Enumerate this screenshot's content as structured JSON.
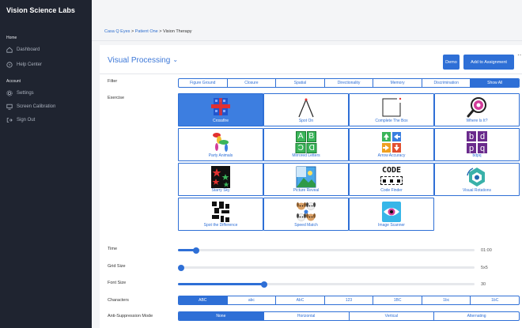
{
  "sidebar": {
    "brand": "Vision Science Labs",
    "home_section": "Home",
    "items": [
      {
        "label": "Dashboard",
        "icon": "home-icon"
      },
      {
        "label": "Help Center",
        "icon": "help-icon"
      }
    ],
    "account_section": "Account",
    "account_items": [
      {
        "label": "Settings",
        "icon": "gear-icon"
      },
      {
        "label": "Screen Calibration",
        "icon": "monitor-icon"
      },
      {
        "label": "Sign Out",
        "icon": "sign-out-icon"
      }
    ]
  },
  "breadcrumb": {
    "crumb1": "Casa Q Eyes",
    "sep": ">",
    "crumb2": "Patient One",
    "crumb3": "Vision Therapy"
  },
  "panel": {
    "title": "Visual Processing",
    "title_caret": "⌄",
    "demo_label": "Demo",
    "assign_label": "Add to Assignment",
    "kebab": "⋯"
  },
  "filter": {
    "label": "Filter",
    "tabs": [
      "Figure Ground",
      "Closure",
      "Spatial",
      "Directionality",
      "Memory",
      "Discrimination",
      "Show All"
    ],
    "active": "Show All"
  },
  "exercise": {
    "label": "Exercise",
    "cards": [
      {
        "label": "Crossfire",
        "icon": "crossfire-icon",
        "selected": true
      },
      {
        "label": "Spot On",
        "icon": "spot-on-icon"
      },
      {
        "label": "Complete The Box",
        "icon": "complete-box-icon"
      },
      {
        "label": "Where Is It?",
        "icon": "magnifier-icon"
      },
      {
        "label": "Party Animals",
        "icon": "balloon-dog-icon"
      },
      {
        "label": "Mirrored Letters",
        "icon": "mirrored-letters-icon"
      },
      {
        "label": "Arrow Accuracy",
        "icon": "arrows-icon"
      },
      {
        "label": "bdpq",
        "icon": "bdpq-icon"
      },
      {
        "label": "Starry Sky",
        "icon": "stars-icon"
      },
      {
        "label": "Picture Reveal",
        "icon": "picture-icon"
      },
      {
        "label": "Code Finder",
        "icon": "code-icon"
      },
      {
        "label": "Visual Rotations",
        "icon": "rotation-icon"
      },
      {
        "label": "Spot the Difference",
        "icon": "pattern-icon"
      },
      {
        "label": "Speed Match",
        "icon": "dogs-icon"
      },
      {
        "label": "Image Scanner",
        "icon": "eye-icon"
      }
    ],
    "bdpq_letters": [
      "b",
      "d",
      "p",
      "q"
    ],
    "code_text": "CODE",
    "mirrored_letters": [
      "A",
      "B",
      "C",
      "D"
    ]
  },
  "time": {
    "label": "Time",
    "value": "01:00",
    "fraction": 0.06
  },
  "grid_size": {
    "label": "Grid Size",
    "value": "5x5",
    "fraction": 0.0
  },
  "font_size": {
    "label": "Font Size",
    "value": "30",
    "fraction": 0.29
  },
  "characters": {
    "label": "Characters",
    "options": [
      "ABC",
      "abc",
      "AbC",
      "123",
      "1BC",
      "1bc",
      "1bC"
    ],
    "active": "ABC"
  },
  "anti_suppression": {
    "label": "Anti-Suppression Mode",
    "options": [
      "None",
      "Horizontal",
      "Vertical",
      "Alternating"
    ],
    "active": "None"
  },
  "colors": {
    "accent": "#2e6fd6",
    "sidebar": "#1f2430"
  }
}
